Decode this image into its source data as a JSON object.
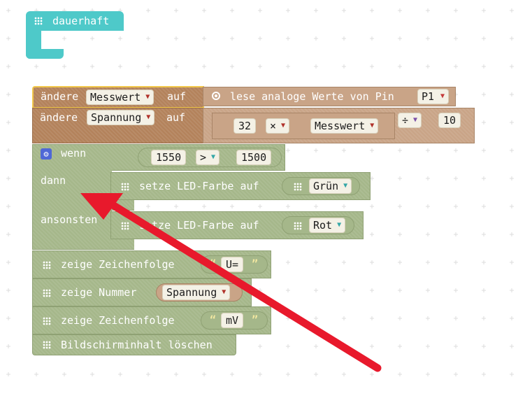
{
  "hat": {
    "label": "dauerhaft",
    "icon": "grid-icon"
  },
  "set_measure": {
    "verb": "ändere",
    "variable": "Messwert",
    "to": "auf",
    "reading": {
      "label": "lese analoge Werte von Pin",
      "pin": "P1",
      "icon": "radio-icon"
    }
  },
  "set_voltage": {
    "verb": "ändere",
    "variable": "Spannung",
    "to": "auf",
    "expr": {
      "factor": "32",
      "times": "×",
      "operand": "Messwert",
      "divide": "÷",
      "divisor": "10"
    }
  },
  "if_block": {
    "if_label": "wenn",
    "then_label": "dann",
    "else_label": "ansonsten",
    "cond": {
      "left": "1550",
      "op": ">",
      "right": "1500"
    },
    "then_action": {
      "label": "setze LED-Farbe auf",
      "color": "Grün"
    },
    "else_action": {
      "label": "setze LED-Farbe auf",
      "color": "Rot"
    }
  },
  "show_string_1": {
    "label": "zeige Zeichenfolge",
    "open_quote": "“",
    "value": "U=",
    "close_quote": "”"
  },
  "show_number": {
    "label": "zeige Nummer",
    "variable": "Spannung"
  },
  "show_string_2": {
    "label": "zeige Zeichenfolge",
    "open_quote": "“",
    "value": "mV",
    "close_quote": "”"
  },
  "clear": {
    "label": "Bildschirminhalt löschen"
  },
  "annotation": {
    "color": "#e8192c"
  },
  "colors": {
    "hat": "#4ec9c9",
    "variables": "#b3825b",
    "basic": "#a5b78a",
    "pin_input": "#c43a3a"
  }
}
